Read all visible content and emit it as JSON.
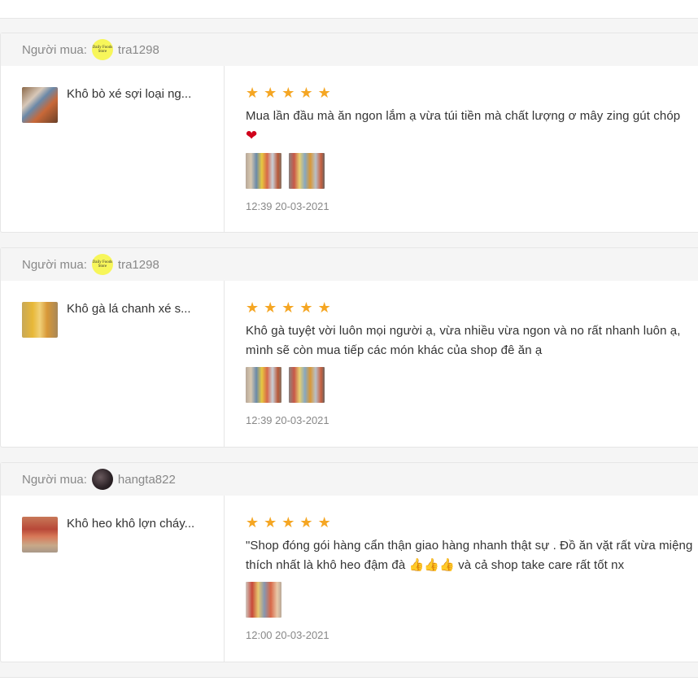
{
  "buyer_label": "Người mua:",
  "reviews": [
    {
      "username": "tra1298",
      "avatar": "daily-foods-store-logo",
      "avatar_text": "Daily Foods Store",
      "product_name": "Khô bò xé sợi loại ng...",
      "rating": 5,
      "comment": "Mua lần đầu mà ăn ngon lắm ạ vừa túi tiền mà chất lượng ơ mây zing gút chóp",
      "comment_emoji": "❤",
      "image_count": 2,
      "time": "12:39 20-03-2021"
    },
    {
      "username": "tra1298",
      "avatar": "daily-foods-store-logo",
      "avatar_text": "Daily Foods Store",
      "product_name": "Khô gà lá chanh xé s...",
      "rating": 5,
      "comment": "Khô gà tuyệt vời luôn mọi người ạ, vừa nhiều vừa ngon và no rất nhanh luôn ạ, mình sẽ còn mua tiếp các món khác của shop đê ăn ạ",
      "image_count": 2,
      "time": "12:39 20-03-2021"
    },
    {
      "username": "hangta822",
      "avatar": "user-photo",
      "product_name": "Khô heo khô lợn cháy...",
      "rating": 5,
      "comment_part1": "\"Shop đóng gói hàng cẩn thận giao hàng nhanh thật sự . Đồ ăn vặt rất vừa miệng thích nhất là khô heo đậm đà",
      "comment_emoji": "👍👍👍",
      "comment_part2": "và cả shop take care rất tốt nx",
      "image_count": 1,
      "time": "12:00 20-03-2021"
    }
  ],
  "colors": {
    "star": "#f5a623",
    "muted_text": "#888888",
    "body_text": "#333333",
    "heart": "#d0021b"
  },
  "icons": {
    "star": "★",
    "heart": "❤"
  }
}
